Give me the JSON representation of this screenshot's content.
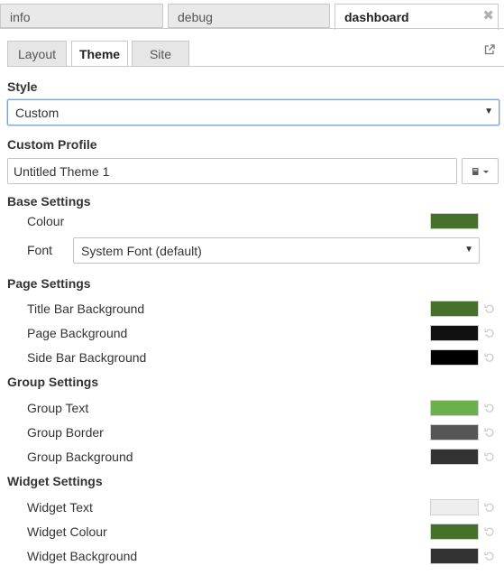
{
  "top_tabs": [
    {
      "label": "info",
      "active": false
    },
    {
      "label": "debug",
      "active": false
    },
    {
      "label": "dashboard",
      "active": true
    }
  ],
  "sub_tabs": [
    {
      "label": "Layout",
      "active": false
    },
    {
      "label": "Theme",
      "active": true
    },
    {
      "label": "Site",
      "active": false
    }
  ],
  "style": {
    "title": "Style",
    "selected": "Custom"
  },
  "custom_profile": {
    "title": "Custom Profile",
    "value": "Untitled Theme 1"
  },
  "base_settings": {
    "title": "Base Settings",
    "colour_label": "Colour",
    "colour": "#447228",
    "font_label": "Font",
    "font_selected": "System Font (default)"
  },
  "page_settings": {
    "title": "Page Settings",
    "items": [
      {
        "label": "Title Bar Background",
        "color": "#447228"
      },
      {
        "label": "Page Background",
        "color": "#111111"
      },
      {
        "label": "Side Bar Background",
        "color": "#000000"
      }
    ]
  },
  "group_settings": {
    "title": "Group Settings",
    "items": [
      {
        "label": "Group Text",
        "color": "#6bb049"
      },
      {
        "label": "Group Border",
        "color": "#555555"
      },
      {
        "label": "Group Background",
        "color": "#333333"
      }
    ]
  },
  "widget_settings": {
    "title": "Widget Settings",
    "items": [
      {
        "label": "Widget Text",
        "color": "#eeeeee"
      },
      {
        "label": "Widget Colour",
        "color": "#447228"
      },
      {
        "label": "Widget Background",
        "color": "#333333"
      }
    ]
  }
}
